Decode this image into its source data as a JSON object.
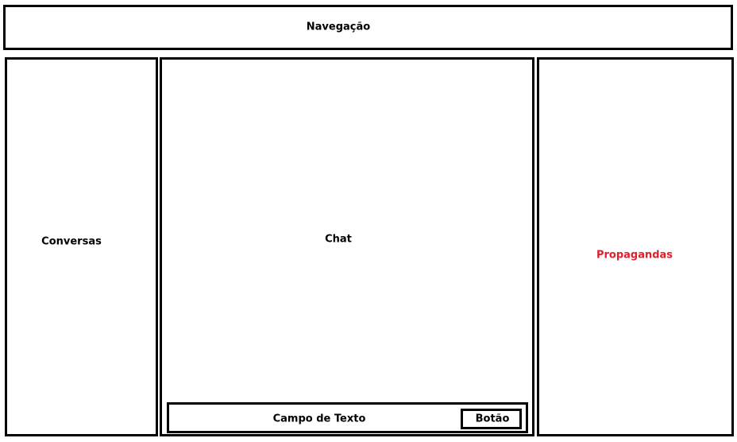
{
  "navigation": {
    "label": "Navegação"
  },
  "sidebar_left": {
    "label": "Conversas"
  },
  "chat": {
    "label": "Chat"
  },
  "sidebar_right": {
    "label": "Propagandas",
    "label_color": "#e0202a"
  },
  "composer": {
    "text_field_label": "Campo de Texto",
    "button_label": "Botão"
  }
}
